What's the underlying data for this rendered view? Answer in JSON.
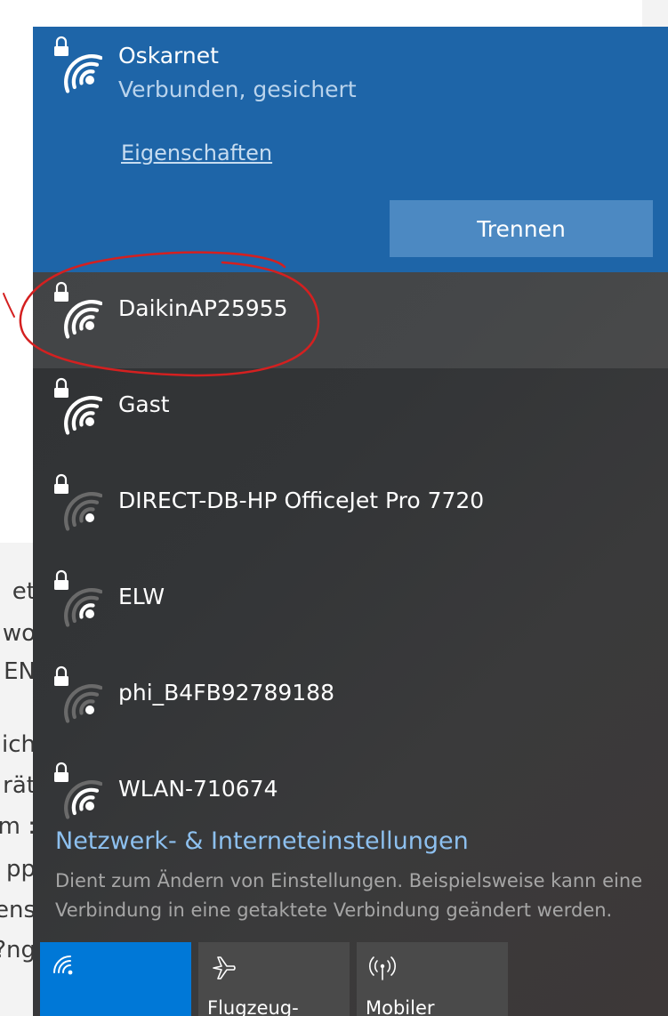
{
  "background_page": {
    "text_fragments": [
      "et",
      "wo",
      "EN",
      "ich",
      "rät",
      ": m",
      "pp",
      "ens",
      "ng?"
    ]
  },
  "connected_network": {
    "name": "Oskarnet",
    "status": "Verbunden, gesichert",
    "properties_link": "Eigenschaften",
    "disconnect_button": "Trennen",
    "signal_bars": 4,
    "secured": true
  },
  "networks": [
    {
      "name": "DaikinAP25955",
      "signal_bars": 4,
      "secured": true,
      "highlighted": true
    },
    {
      "name": "Gast",
      "signal_bars": 4,
      "secured": true
    },
    {
      "name": "DIRECT-DB-HP OfficeJet Pro 7720",
      "signal_bars": 1,
      "secured": true
    },
    {
      "name": "ELW",
      "signal_bars": 2,
      "secured": true
    },
    {
      "name": "phi_B4FB92789188",
      "signal_bars": 1,
      "secured": true
    },
    {
      "name": "WLAN-710674",
      "signal_bars": 3,
      "secured": true
    }
  ],
  "settings": {
    "link": "Netzwerk- & Interneteinstellungen",
    "description": "Dient zum Ändern von Einstellungen. Beispielsweise kann eine Verbindung in eine getaktete Verbindung geändert werden."
  },
  "quick_actions": [
    {
      "label": "",
      "icon": "wifi-icon",
      "active": true
    },
    {
      "label": "Flugzeug-",
      "icon": "airplane-icon",
      "active": false
    },
    {
      "label": "Mobiler",
      "icon": "mobile-hotspot-icon",
      "active": false
    }
  ],
  "colors": {
    "accent": "#1e65a8",
    "tile_active": "#0078d7",
    "tile_inactive": "#4a4a4a",
    "annotation": "#d42020"
  }
}
